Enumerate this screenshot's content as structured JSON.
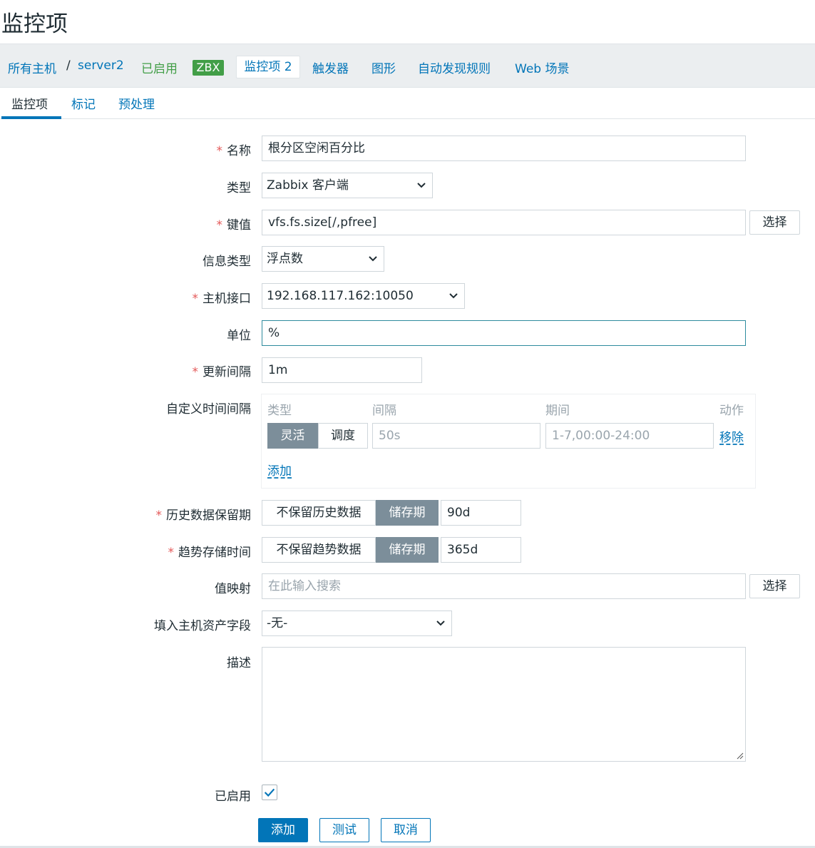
{
  "page_title": "监控项",
  "host_nav": {
    "all_hosts": "所有主机",
    "separator": "/",
    "host": "server2",
    "enabled": "已启用",
    "zbx_badge": "ZBX",
    "items_tab": "监控项 2",
    "triggers": "触发器",
    "graphs": "图形",
    "discovery": "自动发现规则",
    "web": "Web 场景"
  },
  "tabs": [
    "监控项",
    "标记",
    "预处理"
  ],
  "form": {
    "name": {
      "label": "名称",
      "value": "根分区空闲百分比"
    },
    "type": {
      "label": "类型",
      "value": "Zabbix 客户端"
    },
    "key": {
      "label": "键值",
      "value": "vfs.fs.size[/,pfree]",
      "select": "选择"
    },
    "info_type": {
      "label": "信息类型",
      "value": "浮点数"
    },
    "interface": {
      "label": "主机接口",
      "value": "192.168.117.162:10050"
    },
    "units": {
      "label": "单位",
      "value": "%"
    },
    "update_interval": {
      "label": "更新间隔",
      "value": "1m"
    },
    "custom_intervals": {
      "label": "自定义时间间隔",
      "col_type": "类型",
      "col_interval": "间隔",
      "col_period": "期间",
      "col_action": "动作",
      "flexible": "灵活",
      "scheduling": "调度",
      "interval_placeholder": "50s",
      "period_placeholder": "1-7,00:00-24:00",
      "remove": "移除",
      "add": "添加"
    },
    "history": {
      "label": "历史数据保留期",
      "no_keep": "不保留历史数据",
      "storage": "储存期",
      "value": "90d"
    },
    "trends": {
      "label": "趋势存储时间",
      "no_keep": "不保留趋势数据",
      "storage": "储存期",
      "value": "365d"
    },
    "value_map": {
      "label": "值映射",
      "placeholder": "在此输入搜索",
      "select": "选择"
    },
    "inventory": {
      "label": "填入主机资产字段",
      "value": "-无-"
    },
    "description": {
      "label": "描述",
      "value": ""
    },
    "enabled": {
      "label": "已启用",
      "checked": true
    }
  },
  "buttons": {
    "add": "添加",
    "test": "测试",
    "cancel": "取消"
  },
  "colors": {
    "link": "#0275b8",
    "green": "#429e47",
    "required": "#e45959",
    "segment_active": "#7c8e9a"
  }
}
